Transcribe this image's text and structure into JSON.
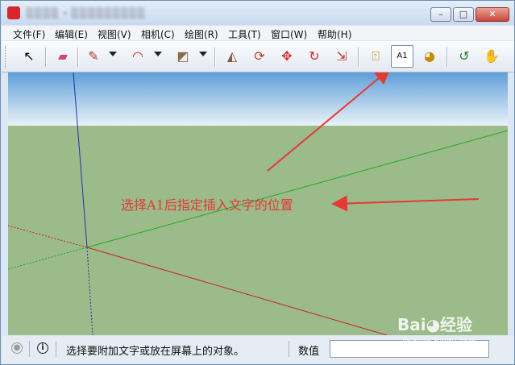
{
  "window": {
    "title": "░░░░ - ░░░░░░░░░",
    "buttons": {
      "minimize": "–",
      "maximize": "□",
      "close": "✕"
    }
  },
  "menu": [
    {
      "label": "文件(F)"
    },
    {
      "label": "编辑(E)"
    },
    {
      "label": "视图(V)"
    },
    {
      "label": "相机(C)"
    },
    {
      "label": "绘图(R)"
    },
    {
      "label": "工具(T)"
    },
    {
      "label": "窗口(W)"
    },
    {
      "label": "帮助(H)"
    }
  ],
  "toolbar": {
    "tools": [
      {
        "name": "select-icon",
        "glyph": "↖"
      },
      {
        "name": "eraser-icon",
        "glyph": "▰"
      },
      {
        "name": "pencil-icon",
        "glyph": "✎"
      },
      {
        "name": "arc-icon",
        "glyph": "◠"
      },
      {
        "name": "rectangle-icon",
        "glyph": "◩"
      },
      {
        "name": "push-pull-icon",
        "glyph": "◭"
      },
      {
        "name": "follow-me-icon",
        "glyph": "⟳"
      },
      {
        "name": "move-icon",
        "glyph": "✥"
      },
      {
        "name": "rotate-icon",
        "glyph": "↻"
      },
      {
        "name": "scale-icon",
        "glyph": "⇲"
      },
      {
        "name": "tape-measure-icon",
        "glyph": "⍐"
      },
      {
        "name": "text-icon",
        "glyph": "A1"
      },
      {
        "name": "paint-bucket-icon",
        "glyph": "◕"
      },
      {
        "name": "orbit-icon",
        "glyph": "↺"
      },
      {
        "name": "pan-icon",
        "glyph": "✋"
      }
    ],
    "active_tool": "text-icon"
  },
  "annotation": {
    "text": "选择A1后指定插入文字的位置",
    "color": "#e53935"
  },
  "status": {
    "hint": "选择要附加文字或放在屏幕上的对象。",
    "value_label": "数值",
    "value": ""
  },
  "watermark": {
    "main": "Bai◕经验",
    "sub": "jingyan.baidu.com"
  },
  "colors": {
    "sky_top": "#5f9fd9",
    "sky_bottom": "#e9f2f7",
    "ground": "#9bbb8a",
    "axis_red": "#cc2222",
    "axis_green": "#22aa22",
    "axis_blue": "#2233aa"
  }
}
